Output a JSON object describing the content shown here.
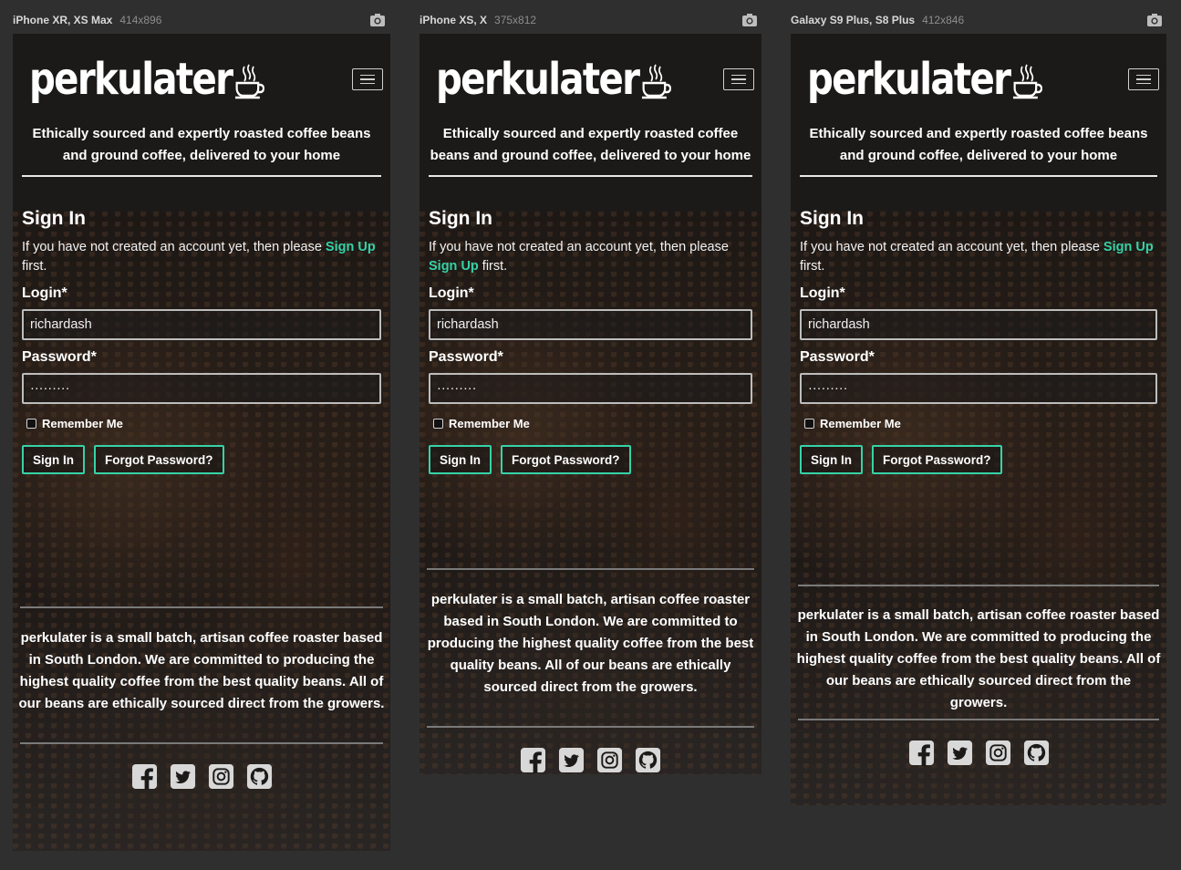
{
  "devices": [
    {
      "name": "iPhone XR, XS Max",
      "size": "414x896"
    },
    {
      "name": "iPhone XS, X",
      "size": "375x812"
    },
    {
      "name": "Galaxy S9 Plus, S8 Plus",
      "size": "412x846"
    }
  ],
  "site": {
    "logo": "perkulater",
    "tagline": "Ethically sourced and expertly roasted coffee beans and ground coffee, delivered to your home"
  },
  "signin": {
    "title": "Sign In",
    "intro_before": "If you have not created an account yet, then please ",
    "intro_link": "Sign Up",
    "intro_after": " first.",
    "login_label": "Login*",
    "login_value": "richardash",
    "password_label": "Password*",
    "password_value": "·········",
    "remember_label": "Remember Me",
    "signin_button": "Sign In",
    "forgot_button": "Forgot Password?"
  },
  "footer": {
    "about": "perkulater is a small batch, artisan coffee roaster based in South London. We are committed to producing the highest quality coffee from the best quality beans. All of our beans are ethically sourced direct from the growers.",
    "social_icons": [
      "facebook-icon",
      "twitter-icon",
      "instagram-icon",
      "github-icon"
    ]
  },
  "colors": {
    "accent": "#35d3a7",
    "background": "#2f2f2f",
    "frame": "#1c1a19"
  }
}
